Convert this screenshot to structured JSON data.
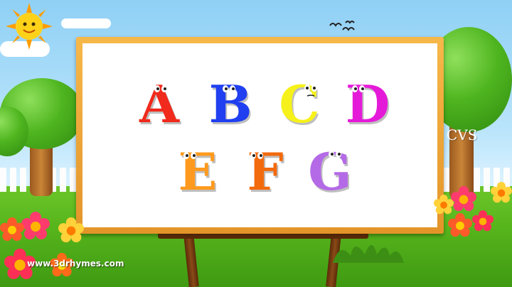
{
  "board": {
    "letters": [
      {
        "char": "A",
        "color": "#f02a1c"
      },
      {
        "char": "B",
        "color": "#1f3ff0"
      },
      {
        "char": "C",
        "color": "#f6f11a"
      },
      {
        "char": "D",
        "color": "#e51ad9"
      },
      {
        "char": "E",
        "color": "#ff9a1e"
      },
      {
        "char": "F",
        "color": "#f26a0c"
      },
      {
        "char": "G",
        "color": "#b46ae6"
      }
    ]
  },
  "overlay": {
    "corner_text": "CVS",
    "watermark": "www.3drhymes.com"
  },
  "colors": {
    "frame": "#f0a53a",
    "grass": "#5ab81e",
    "sky": "#a9dcf8"
  },
  "icons": [
    "sun-icon",
    "bird-icon",
    "flower-icon",
    "tree-icon",
    "cloud-icon"
  ]
}
